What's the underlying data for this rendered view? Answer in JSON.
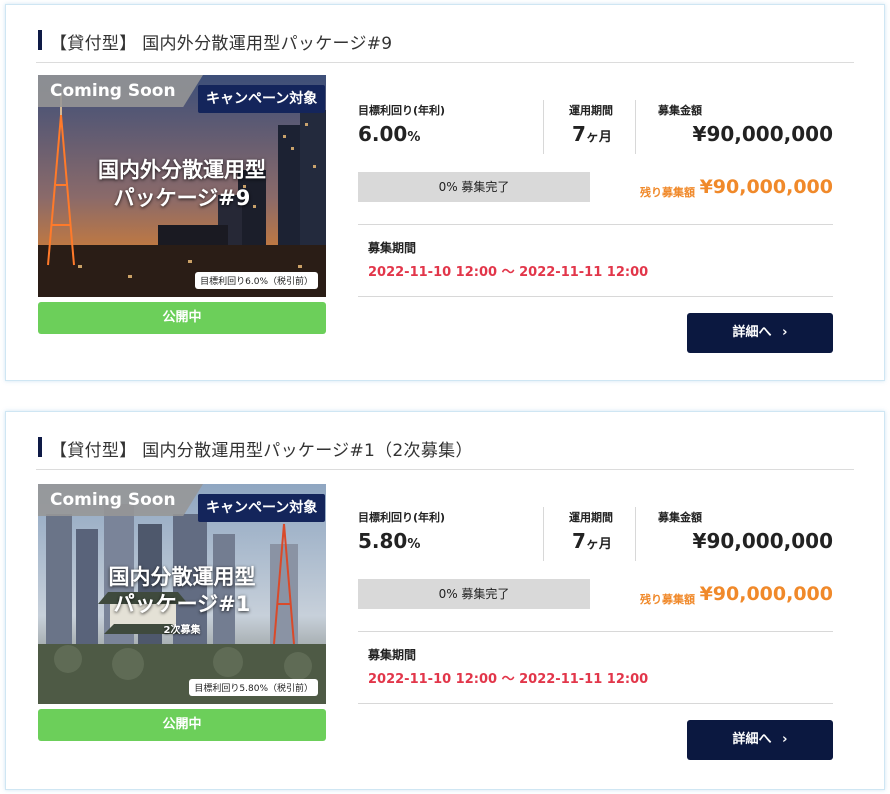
{
  "labels": {
    "coming_soon": "Coming Soon",
    "campaign": "キャンペーン対象",
    "status": "公開中",
    "yield_label": "目標利回り(年利)",
    "term_label": "運用期間",
    "amount_label": "募集金額",
    "remaining_label": "残り募集額",
    "period_label": "募集期間",
    "detail_button": "詳細へ",
    "detail_chevron": "›"
  },
  "colors": {
    "navy": "#0b1840",
    "green": "#6ccf5a",
    "orange": "#f0892a",
    "red": "#e2364a"
  },
  "funds": [
    {
      "title": "【貸付型】 国内外分散運用型パッケージ#9",
      "thumb_title_line1": "国内外分散運用型",
      "thumb_title_line2": "パッケージ#9",
      "thumb_subtitle": "",
      "thumb_yield": "目標利回り6.0%（税引前）",
      "yield_value": "6.00",
      "yield_unit": "%",
      "term_value": "7",
      "term_unit": "ヶ月",
      "amount": "¥90,000,000",
      "progress_text": "0% 募集完了",
      "progress_percent": 0,
      "remaining": "¥90,000,000",
      "period": "2022-11-10 12:00 ～ 2022-11-11 12:00"
    },
    {
      "title": "【貸付型】 国内分散運用型パッケージ#1（2次募集）",
      "thumb_title_line1": "国内分散運用型",
      "thumb_title_line2": "パッケージ#1",
      "thumb_subtitle": "2次募集",
      "thumb_yield": "目標利回り5.80%（税引前）",
      "yield_value": "5.80",
      "yield_unit": "%",
      "term_value": "7",
      "term_unit": "ヶ月",
      "amount": "¥90,000,000",
      "progress_text": "0% 募集完了",
      "progress_percent": 0,
      "remaining": "¥90,000,000",
      "period": "2022-11-10 12:00 ～ 2022-11-11 12:00"
    }
  ]
}
